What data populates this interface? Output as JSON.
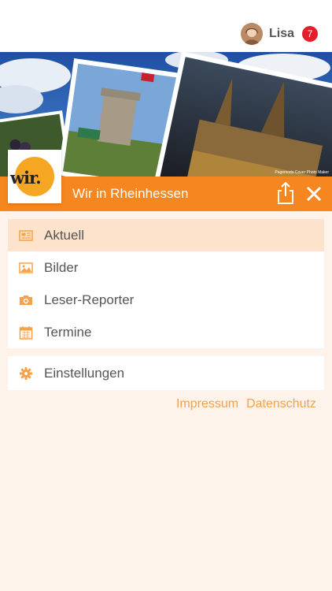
{
  "header": {
    "user_name": "Lisa",
    "notification_count": "7",
    "avatar": "user-avatar"
  },
  "banner": {
    "watermark": "Pagemodo Cover Photo Maker"
  },
  "titlebar": {
    "logo_text": "wir.",
    "title": "Wir in Rheinhessen",
    "share_icon": "share-icon",
    "close_icon": "close-icon"
  },
  "menu": {
    "items": [
      {
        "label": "Aktuell",
        "icon": "newspaper-icon",
        "active": true
      },
      {
        "label": "Bilder",
        "icon": "image-icon",
        "active": false
      },
      {
        "label": "Leser-Reporter",
        "icon": "camera-icon",
        "active": false
      },
      {
        "label": "Termine",
        "icon": "calendar-icon",
        "active": false
      }
    ],
    "settings": {
      "label": "Einstellungen",
      "icon": "gear-icon"
    }
  },
  "footer": {
    "impressum": "Impressum",
    "datenschutz": "Datenschutz"
  },
  "colors": {
    "accent": "#f6861f",
    "active_row": "#fde2cc",
    "background": "#fdf3ea",
    "icon": "#f5a24a",
    "badge": "#e31f2a"
  }
}
